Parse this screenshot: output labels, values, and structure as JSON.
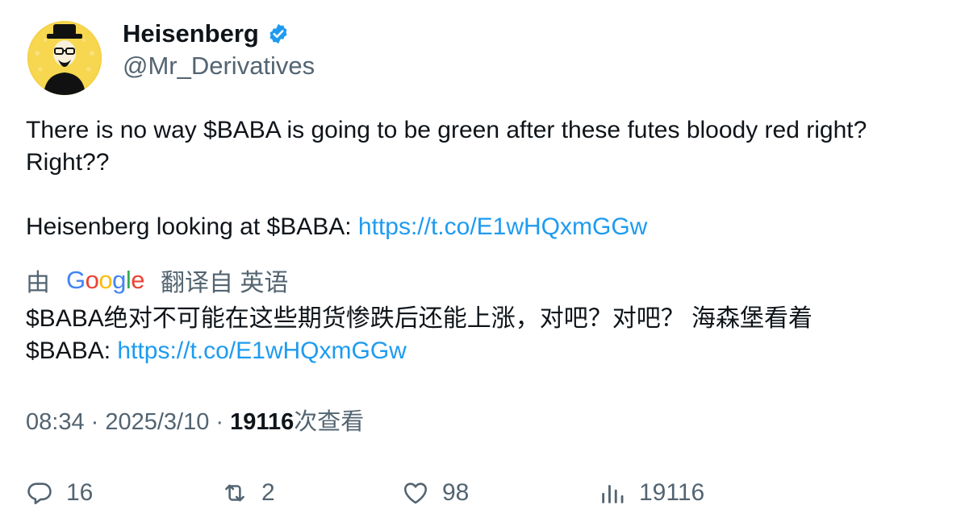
{
  "author": {
    "display_name": "Heisenberg",
    "handle": "@Mr_Derivatives",
    "verified": true,
    "avatar_icon": "heisenberg-avatar"
  },
  "tweet": {
    "line1": "There is no way $BABA is going to be green after these futes bloody red right?",
    "line2": "Right??",
    "line3_text": "Heisenberg looking at $BABA: ",
    "line3_link": "https://t.co/E1wHQxmGGw"
  },
  "translation": {
    "prefix": "由",
    "provider": "Google",
    "suffix": "翻译自 英语",
    "line1": "$BABA绝对不可能在这些期货惨跌后还能上涨，对吧？对吧？ 海森堡看着",
    "line2_text": "$BABA: ",
    "line2_link": "https://t.co/E1wHQxmGGw"
  },
  "meta": {
    "time": "08:34",
    "sep1": " · ",
    "date": "2025/3/10",
    "sep2": " · ",
    "views_count": "19116",
    "views_label": "次查看"
  },
  "actions": {
    "replies": "16",
    "retweets": "2",
    "likes": "98",
    "views": "19116"
  },
  "colors": {
    "link": "#1d9bf0",
    "muted": "#536471",
    "text": "#0f1419",
    "verified": "#1d9bf0"
  }
}
